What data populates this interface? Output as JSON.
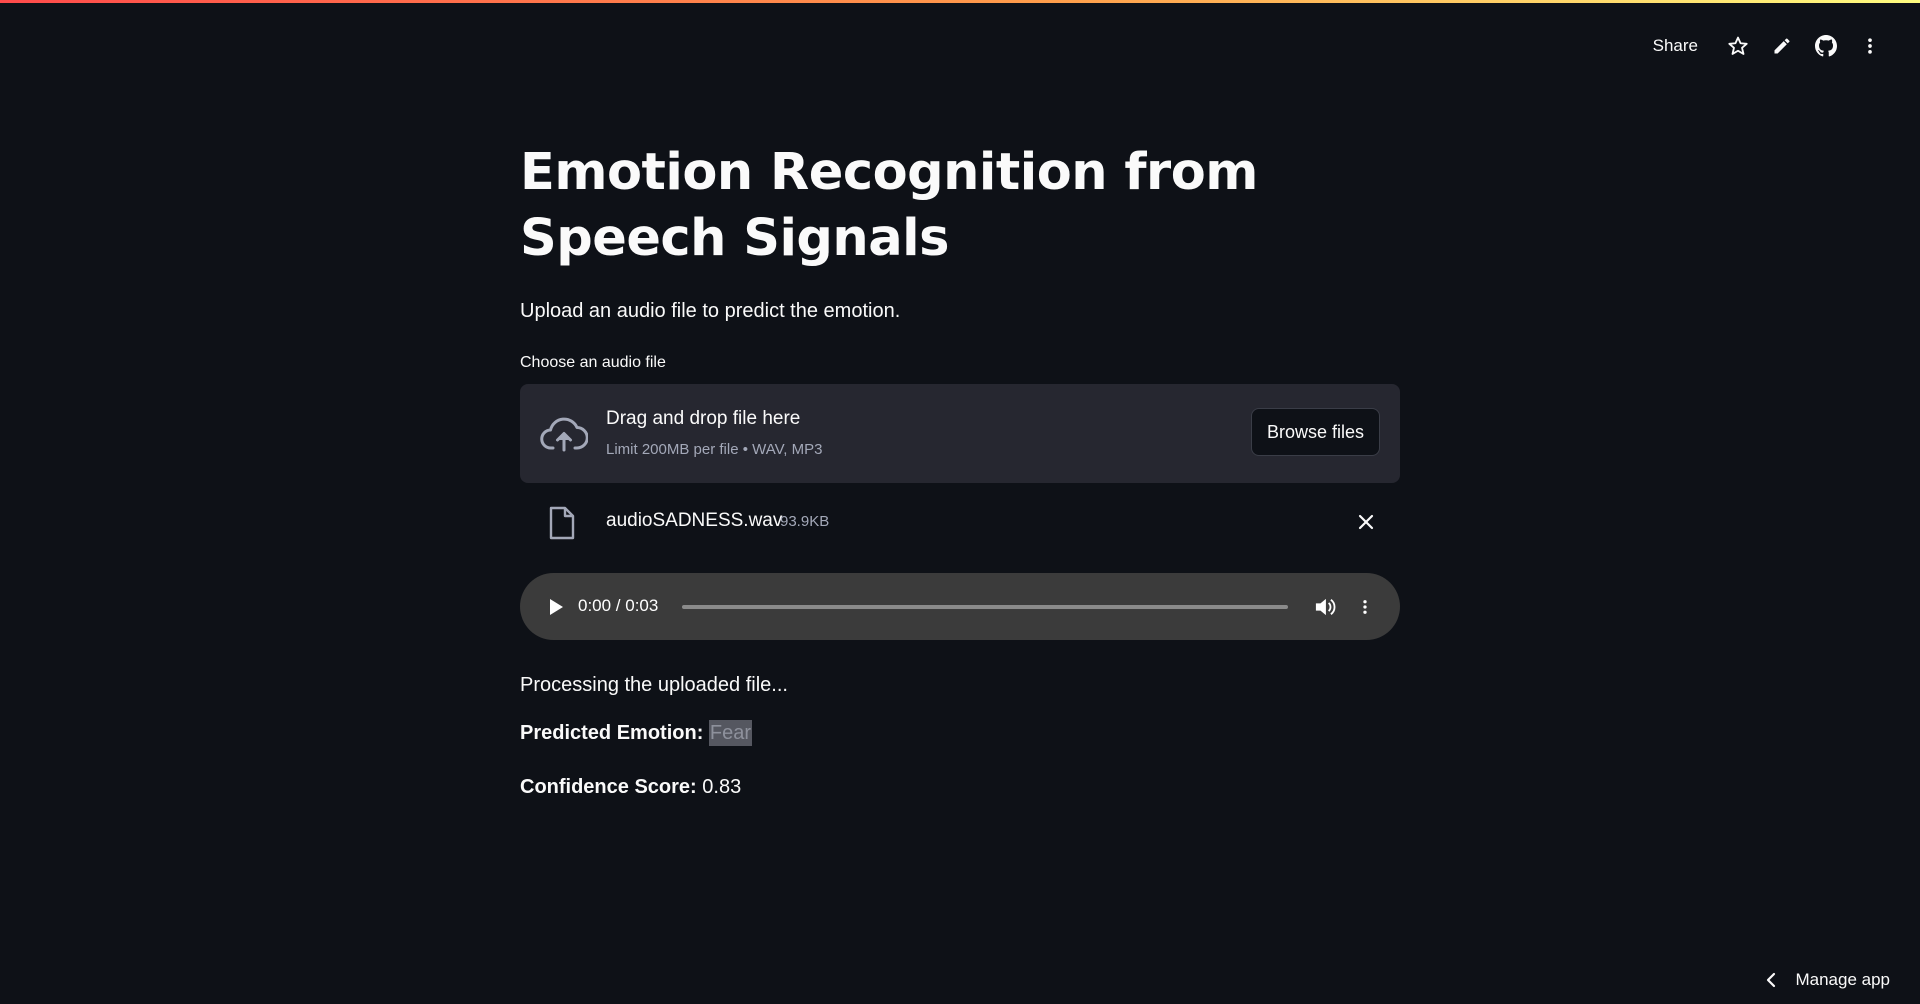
{
  "colors": {
    "background": "#0e1117",
    "surface": "#262730",
    "text": "#fafafa",
    "muted_text": "#a3a8b8",
    "player_bg": "#3b3b3b",
    "stripe_start": "#ff4b4b",
    "stripe_end": "#fffd80"
  },
  "toolbar": {
    "share_label": "Share",
    "icons": [
      "star-icon",
      "pencil-icon",
      "github-icon",
      "more-vertical-icon"
    ]
  },
  "page": {
    "title": "Emotion Recognition from Speech Signals",
    "subtitle": "Upload an audio file to predict the emotion."
  },
  "uploader": {
    "label": "Choose an audio file",
    "drop_title": "Drag and drop file here",
    "limit_text": "Limit 200MB per file • WAV, MP3",
    "browse_label": "Browse files",
    "icon": "cloud-upload-icon"
  },
  "uploaded_file": {
    "name": "audioSADNESS.wav",
    "size": "93.9KB",
    "icon": "file-icon"
  },
  "audio_player": {
    "time": "0:00 / 0:03",
    "progress": 0
  },
  "results": {
    "processing_text": "Processing the uploaded file...",
    "emotion_label": "Predicted Emotion:",
    "emotion_value": "Fear",
    "confidence_label": "Confidence Score:",
    "confidence_value": "0.83"
  },
  "footer": {
    "manage_label": "Manage app"
  }
}
